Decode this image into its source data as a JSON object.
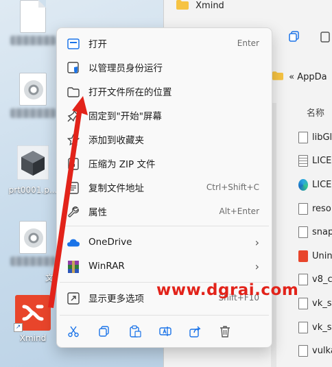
{
  "desktop": {
    "icons": [
      {
        "name": "blank-file",
        "label": ""
      },
      {
        "name": "disc-image-file-1",
        "label": ""
      },
      {
        "name": "cube-file",
        "label": "prt0001.p..."
      },
      {
        "name": "disc-image-file-2",
        "label": ""
      },
      {
        "name": "xmind-shortcut",
        "label": "Xmind"
      }
    ],
    "stray_char": "文"
  },
  "explorer": {
    "title": "Xmind",
    "path": "« AppDa",
    "column_header": "名称",
    "files": [
      {
        "name": "libGl",
        "icon": "file-icon"
      },
      {
        "name": "LICE",
        "icon": "text-file-icon"
      },
      {
        "name": "LICE",
        "icon": "edge-icon"
      },
      {
        "name": "reso",
        "icon": "file-icon"
      },
      {
        "name": "snap",
        "icon": "file-icon"
      },
      {
        "name": "Unin",
        "icon": "xmind-uninstall-icon"
      },
      {
        "name": "v8_c",
        "icon": "file-icon"
      },
      {
        "name": "vk_s",
        "icon": "settings-file-icon"
      },
      {
        "name": "vk_s",
        "icon": "file-icon"
      },
      {
        "name": "vulka",
        "icon": "settings-file-icon"
      }
    ]
  },
  "context_menu": {
    "items": [
      {
        "label": "打开",
        "shortcut": "Enter",
        "icon": "open-window-icon"
      },
      {
        "label": "以管理员身份运行",
        "shortcut": "",
        "icon": "shield-window-icon"
      },
      {
        "label": "打开文件所在的位置",
        "shortcut": "",
        "icon": "folder-icon"
      },
      {
        "label": "固定到\"开始\"屏幕",
        "shortcut": "",
        "icon": "pin-icon"
      },
      {
        "label": "添加到收藏夹",
        "shortcut": "",
        "icon": "star-icon"
      },
      {
        "label": "压缩为 ZIP 文件",
        "shortcut": "",
        "icon": "zip-icon"
      },
      {
        "label": "复制文件地址",
        "shortcut": "Ctrl+Shift+C",
        "icon": "copy-path-icon"
      },
      {
        "label": "属性",
        "shortcut": "Alt+Enter",
        "icon": "wrench-icon"
      },
      {
        "label": "OneDrive",
        "shortcut": "",
        "icon": "onedrive-cloud-icon"
      },
      {
        "label": "WinRAR",
        "shortcut": "",
        "icon": "winrar-icon"
      },
      {
        "label": "显示更多选项",
        "shortcut": "Shift+F10",
        "icon": "show-more-icon"
      }
    ],
    "bottom_actions": [
      "cut-icon",
      "copy-icon",
      "paste-icon",
      "rename-icon",
      "share-icon",
      "delete-icon"
    ]
  },
  "watermark": "www.dgrai.com",
  "colors": {
    "accent": "#1a73e8",
    "annotation_red": "#e2231a",
    "xmind_brand": "#e8452b"
  }
}
